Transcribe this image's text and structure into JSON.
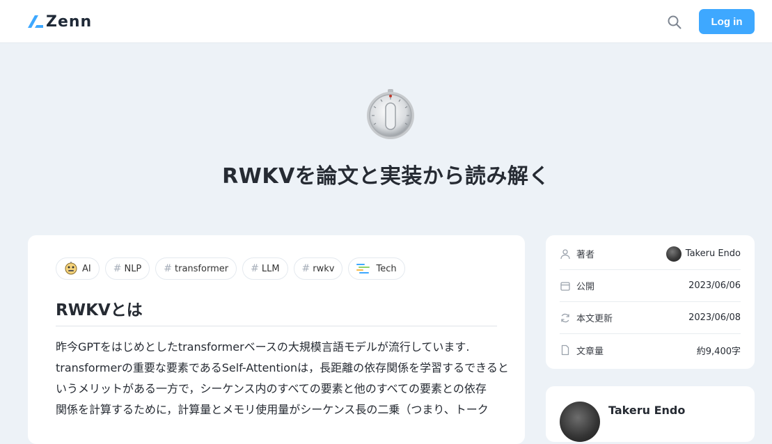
{
  "header": {
    "logo_text": "Zenn",
    "search_icon": "search-icon",
    "login_label": "Log in",
    "accent_color": "#3ea8ff"
  },
  "hero": {
    "emoji": "timer-clock-emoji",
    "title": "RWKVを論文と実装から読み解く"
  },
  "article": {
    "tags": [
      {
        "label": "AI",
        "icon": "ai-topic-icon"
      },
      {
        "label": "NLP",
        "icon": "hash"
      },
      {
        "label": "transformer",
        "icon": "hash"
      },
      {
        "label": "LLM",
        "icon": "hash"
      },
      {
        "label": "rwkv",
        "icon": "hash"
      },
      {
        "label": "Tech",
        "icon": "tech-topic-icon"
      }
    ],
    "heading": "RWKVとは",
    "paragraph_lines": [
      "昨今GPTをはじめとしたtransformerベースの大規模言語モデルが流行しています.",
      "transformerの重要な要素であるSelf-Attentionは，長距離の依存関係を学習するできると",
      "いうメリットがある一方で，シーケンス内のすべての要素と他のすべての要素との依存",
      "関係を計算するために，計算量とメモリ使用量がシーケンス長の二乗（つまり、トーク"
    ]
  },
  "meta": {
    "rows": [
      {
        "icon": "person-icon",
        "label": "著者",
        "value": "Takeru Endo"
      },
      {
        "icon": "calendar-icon",
        "label": "公開",
        "value": "2023/06/06"
      },
      {
        "icon": "refresh-icon",
        "label": "本文更新",
        "value": "2023/06/08"
      },
      {
        "icon": "document-icon",
        "label": "文章量",
        "value": "約9,400字"
      }
    ]
  },
  "author_card": {
    "name": "Takeru Endo"
  }
}
